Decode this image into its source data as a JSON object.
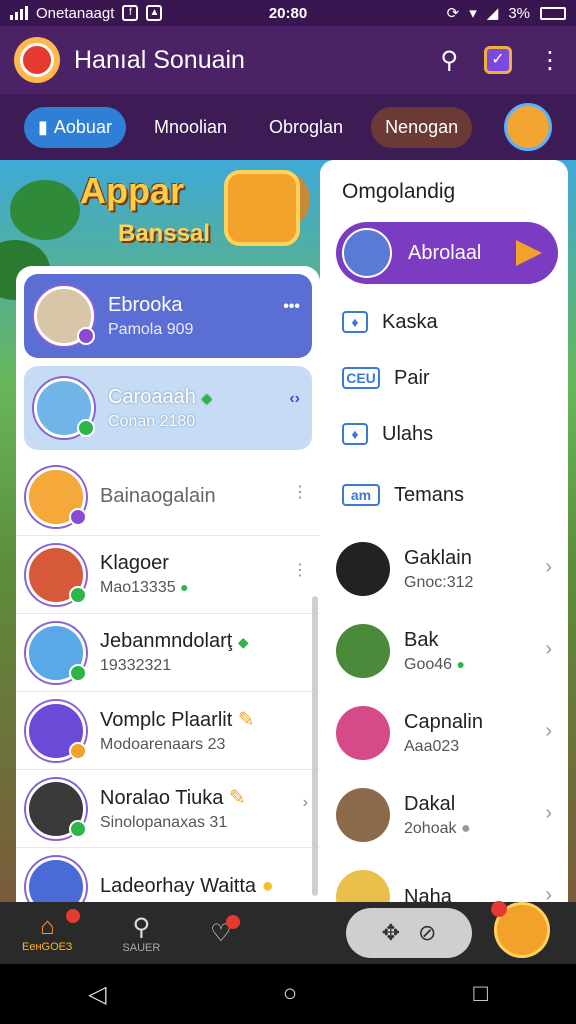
{
  "status": {
    "carrier": "Onetanaagt",
    "time": "20:80",
    "battery": "3%"
  },
  "appbar": {
    "title": "Hanıal Sonuain"
  },
  "tabs": [
    {
      "label": "Aobuar"
    },
    {
      "label": "Mnoolian"
    },
    {
      "label": "Obroglan"
    },
    {
      "label": "Nenogan"
    }
  ],
  "banner": {
    "line1": "Appar",
    "line2": "Banssal"
  },
  "list": [
    {
      "name": "Ebrooka",
      "sub": "Pamola 909",
      "more": "•••"
    },
    {
      "name": "Caroaaah",
      "sub": "Conan 2180",
      "more": "‹›"
    },
    {
      "name": "Bainaogalain",
      "sub": "",
      "more": "⋮"
    },
    {
      "name": "Klagoer",
      "sub": "Mao13335",
      "more": "⋮"
    },
    {
      "name": "Jebanmndolarţ",
      "sub": "19332321",
      "more": ""
    },
    {
      "name": "Vomplc Plaarlit",
      "sub": "Modoarenaars 23",
      "more": ""
    },
    {
      "name": "Noralao Tiuka",
      "sub": "Sinolopanaxas 31",
      "more": "›"
    },
    {
      "name": "Ladeorhay Waitta",
      "sub": "",
      "more": ""
    }
  ],
  "panel": {
    "heading": "Omgolandig",
    "selected": "Abrolaal",
    "menu": [
      {
        "icon": "thumb",
        "label": "Kaska"
      },
      {
        "icon": "ceu",
        "label": "Pair"
      },
      {
        "icon": "thumb",
        "label": "Ulahs"
      },
      {
        "icon": "tam",
        "label": "Temans"
      }
    ],
    "friends": [
      {
        "name": "Gaklain",
        "sub": "Gnoc:312"
      },
      {
        "name": "Bak",
        "sub": "Goo46"
      },
      {
        "name": "Capnalin",
        "sub": "Aaa023"
      },
      {
        "name": "Dakal",
        "sub": "2ohoak"
      },
      {
        "name": "Naha",
        "sub": ""
      }
    ]
  },
  "nav": {
    "home": "ЕенGОЕЗ",
    "search": "SAUER"
  }
}
